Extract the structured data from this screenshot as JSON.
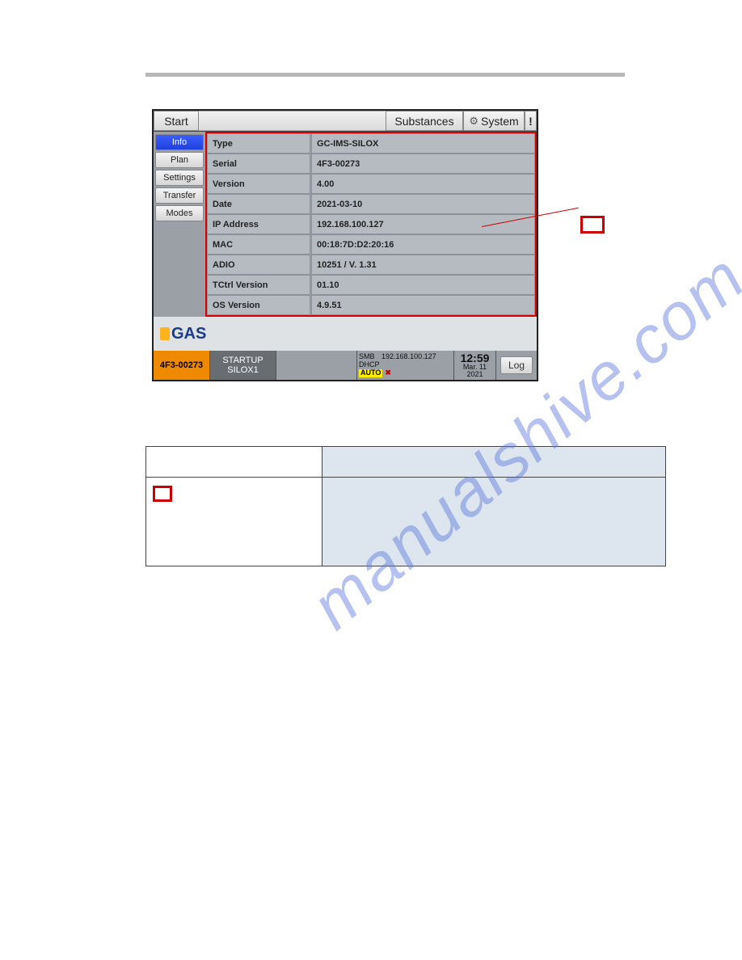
{
  "topbar": {
    "start": "Start",
    "substances": "Substances",
    "system": "System",
    "exclaim": "!"
  },
  "sidemenu": [
    {
      "label": "Info",
      "active": true
    },
    {
      "label": "Plan",
      "active": false
    },
    {
      "label": "Settings",
      "active": false
    },
    {
      "label": "Transfer",
      "active": false
    },
    {
      "label": "Modes",
      "active": false
    }
  ],
  "info": [
    {
      "k": "Type",
      "v": "GC-IMS-SILOX"
    },
    {
      "k": "Serial",
      "v": "4F3-00273"
    },
    {
      "k": "Version",
      "v": "4.00"
    },
    {
      "k": "Date",
      "v": "2021-03-10"
    },
    {
      "k": "IP Address",
      "v": "192.168.100.127"
    },
    {
      "k": "MAC",
      "v": "00:18:7D:D2:20:16"
    },
    {
      "k": "ADIO",
      "v": "10251 / V. 1.31"
    },
    {
      "k": "TCtrl Version",
      "v": "01.10"
    },
    {
      "k": "OS Version",
      "v": "4.9.51"
    }
  ],
  "logo": "GAS",
  "status": {
    "serial": "4F3-00273",
    "mode1": "STARTUP",
    "mode2": "SILOX1",
    "smb": "SMB",
    "ip": "192.168.100.127",
    "dhcp": "DHCP",
    "auto": "AUTO",
    "time": "12:59",
    "date": "Mar. 11",
    "year": "2021",
    "log": "Log"
  }
}
